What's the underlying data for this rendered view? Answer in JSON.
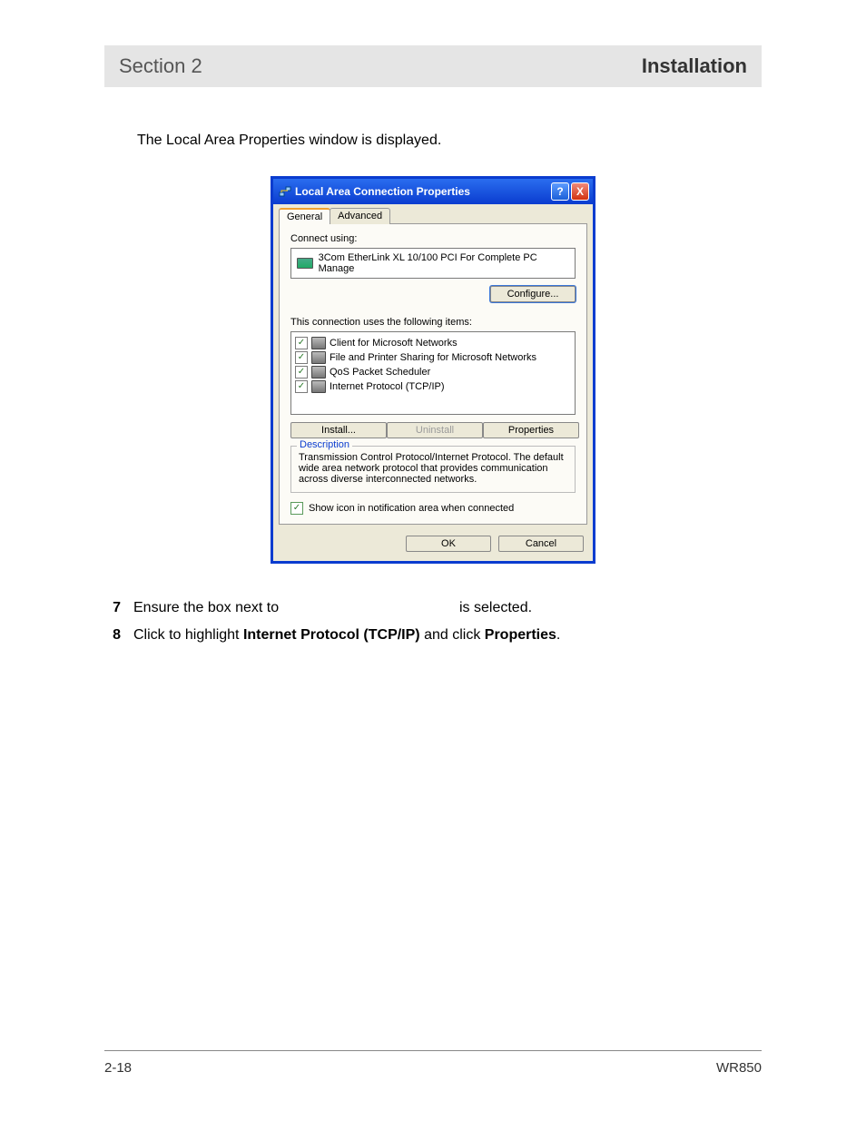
{
  "header": {
    "section": "Section 2",
    "title": "Installation"
  },
  "intro": "The Local Area Properties window is displayed.",
  "dialog": {
    "title": "Local Area Connection Properties",
    "help_btn": "?",
    "close_btn": "X",
    "tabs": {
      "general": "General",
      "advanced": "Advanced"
    },
    "connect_using_label": "Connect using:",
    "adapter": "3Com EtherLink XL 10/100 PCI For Complete PC Manage",
    "configure_btn": "Configure...",
    "items_label": "This connection uses the following items:",
    "items": [
      {
        "label": "Client for Microsoft Networks",
        "checked": true
      },
      {
        "label": "File and Printer Sharing for Microsoft Networks",
        "checked": true
      },
      {
        "label": "QoS Packet Scheduler",
        "checked": true
      },
      {
        "label": "Internet Protocol (TCP/IP)",
        "checked": true
      }
    ],
    "install_btn": "Install...",
    "uninstall_btn": "Uninstall",
    "properties_btn": "Properties",
    "description_legend": "Description",
    "description_text": "Transmission Control Protocol/Internet Protocol. The default wide area network protocol that provides communication across diverse interconnected networks.",
    "show_icon_label": "Show icon in notification area when connected",
    "ok_btn": "OK",
    "cancel_btn": "Cancel"
  },
  "steps": {
    "s7": {
      "num": "7",
      "pre": "Ensure the box next to ",
      "post": " is selected."
    },
    "s8": {
      "num": "8",
      "pre": "Click to highlight ",
      "b1": "Internet Protocol (TCP/IP)",
      "mid": " and click ",
      "b2": "Properties",
      "post": "."
    }
  },
  "footer": {
    "page": "2-18",
    "model": "WR850"
  }
}
